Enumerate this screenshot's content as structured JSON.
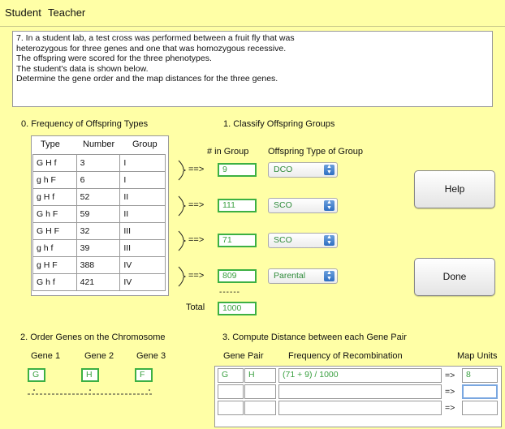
{
  "menu": {
    "student": "Student",
    "teacher": "Teacher"
  },
  "problem_lines": [
    "7. In a student lab, a test cross was performed between a fruit fly that was",
    "heterozygous for three genes and one that was homozygous recessive.",
    "The offspring were scored for the three phenotypes.",
    "The student's data is shown below.",
    "Determine the gene order and the map distances for the three genes."
  ],
  "section0": {
    "title": "0. Frequency of Offspring Types",
    "col_type": "Type",
    "col_number": "Number",
    "col_group": "Group"
  },
  "offspring_rows": [
    {
      "type": "G H f",
      "number": "3",
      "group": "I"
    },
    {
      "type": "g h F",
      "number": "6",
      "group": "I"
    },
    {
      "type": "g H f",
      "number": "52",
      "group": "II"
    },
    {
      "type": "G h F",
      "number": "59",
      "group": "II"
    },
    {
      "type": "G H F",
      "number": "32",
      "group": "III"
    },
    {
      "type": "g h f",
      "number": "39",
      "group": "III"
    },
    {
      "type": "g H F",
      "number": "388",
      "group": "IV"
    },
    {
      "type": "G h f",
      "number": "421",
      "group": "IV"
    }
  ],
  "section1": {
    "title": "1. Classify Offspring Groups",
    "col_in_group": "# in Group",
    "col_offspring_type": "Offspring Type of Group"
  },
  "groups": [
    {
      "arrow": "==>",
      "count": "9",
      "type": "DCO"
    },
    {
      "arrow": "==>",
      "count": "111",
      "type": "SCO"
    },
    {
      "arrow": "==>",
      "count": "71",
      "type": "SCO"
    },
    {
      "arrow": "==>",
      "count": "809",
      "type": "Parental"
    }
  ],
  "total": {
    "dashes": "------",
    "label": "Total",
    "value": "1000"
  },
  "buttons": {
    "help": "Help",
    "done": "Done"
  },
  "section2": {
    "title": "2. Order Genes on the Chromosome",
    "gene1_label": "Gene 1",
    "gene2_label": "Gene 2",
    "gene3_label": "Gene 3",
    "gene1": "G",
    "gene2": "H",
    "gene3": "F"
  },
  "section3": {
    "title": "3. Compute Distance between each Gene Pair",
    "col_gene_pair": "Gene Pair",
    "col_freq": "Frequency of Recombination",
    "col_map_units": "Map Units"
  },
  "distance_rows": [
    {
      "gene_a": "G",
      "gene_b": "H",
      "frequency": "(71 + 9) / 1000",
      "arrow": "=>",
      "map_units": "8"
    },
    {
      "gene_a": "",
      "gene_b": "",
      "frequency": "",
      "arrow": "=>",
      "map_units": ""
    },
    {
      "gene_a": "",
      "gene_b": "",
      "frequency": "",
      "arrow": "=>",
      "map_units": ""
    }
  ],
  "colors": {
    "background": "#ffffa6",
    "field_border": "#3cb043",
    "field_text": "#3aa040"
  }
}
